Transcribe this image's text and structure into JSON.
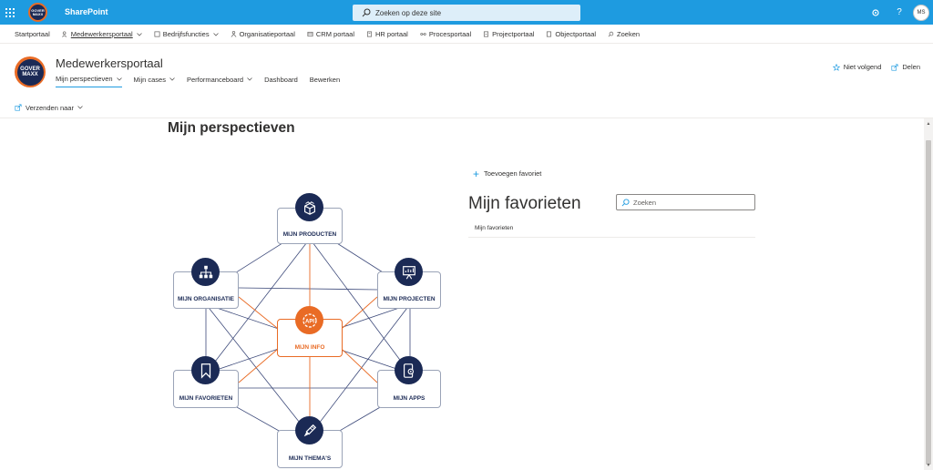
{
  "suite": {
    "logo_text": "GOVER\nMAXX",
    "title": "SharePoint",
    "search_placeholder": "Zoeken op deze site",
    "avatar_initials": "MS"
  },
  "hub_nav": [
    {
      "label": "Startportaal",
      "icon": "none",
      "dropdown": false,
      "active": false
    },
    {
      "label": "Medewerkersportaal",
      "icon": "people-icon",
      "dropdown": true,
      "active": true
    },
    {
      "label": "Bedrijfsfuncties",
      "icon": "grid-icon",
      "dropdown": true,
      "active": false
    },
    {
      "label": "Organisatieportaal",
      "icon": "org-icon",
      "dropdown": false,
      "active": false
    },
    {
      "label": "CRM portaal",
      "icon": "crm-icon",
      "dropdown": false,
      "active": false
    },
    {
      "label": "HR portaal",
      "icon": "hr-icon",
      "dropdown": false,
      "active": false
    },
    {
      "label": "Procesportaal",
      "icon": "process-icon",
      "dropdown": false,
      "active": false
    },
    {
      "label": "Projectportaal",
      "icon": "project-icon",
      "dropdown": false,
      "active": false
    },
    {
      "label": "Objectportaal",
      "icon": "object-icon",
      "dropdown": false,
      "active": false
    },
    {
      "label": "Zoeken",
      "icon": "search-icon",
      "dropdown": false,
      "active": false
    }
  ],
  "site": {
    "logo_text": "GOVER\nMAXX",
    "title": "Medewerkersportaal",
    "nav": [
      {
        "label": "Mijn perspectieven",
        "dropdown": true,
        "active": true
      },
      {
        "label": "Mijn cases",
        "dropdown": true,
        "active": false
      },
      {
        "label": "Performanceboard",
        "dropdown": true,
        "active": false
      },
      {
        "label": "Dashboard",
        "dropdown": false,
        "active": false
      },
      {
        "label": "Bewerken",
        "dropdown": false,
        "active": false
      }
    ],
    "follow_label": "Niet volgend",
    "share_label": "Delen"
  },
  "command_bar": {
    "send_label": "Verzenden naar"
  },
  "page": {
    "section_title": "Mijn perspectieven"
  },
  "diagram": {
    "nodes": [
      {
        "id": "producten",
        "label": "MIJN PRODUCTEN",
        "icon": "box-icon"
      },
      {
        "id": "organisatie",
        "label": "MIJN ORGANISATIE",
        "icon": "org-chart-icon"
      },
      {
        "id": "projecten",
        "label": "MIJN PROJECTEN",
        "icon": "presentation-icon"
      },
      {
        "id": "info",
        "label": "MIJN INFO",
        "icon": "api-gear-icon"
      },
      {
        "id": "favorieten",
        "label": "MIJN FAVORIETEN",
        "icon": "bookmark-icon"
      },
      {
        "id": "apps",
        "label": "MIJN APPS",
        "icon": "phone-gear-icon"
      },
      {
        "id": "themas",
        "label": "MIJN THEMA'S",
        "icon": "paintbrush-icon"
      }
    ],
    "info_icon_text": "API",
    "colors": {
      "navy": "#1b2a55",
      "orange": "#e96b25",
      "line": "#3d4a7a"
    }
  },
  "favorites": {
    "add_label": "Toevoegen favoriet",
    "title": "Mijn favorieten",
    "search_placeholder": "Zoeken",
    "column_header": "Mijn favorieten"
  }
}
